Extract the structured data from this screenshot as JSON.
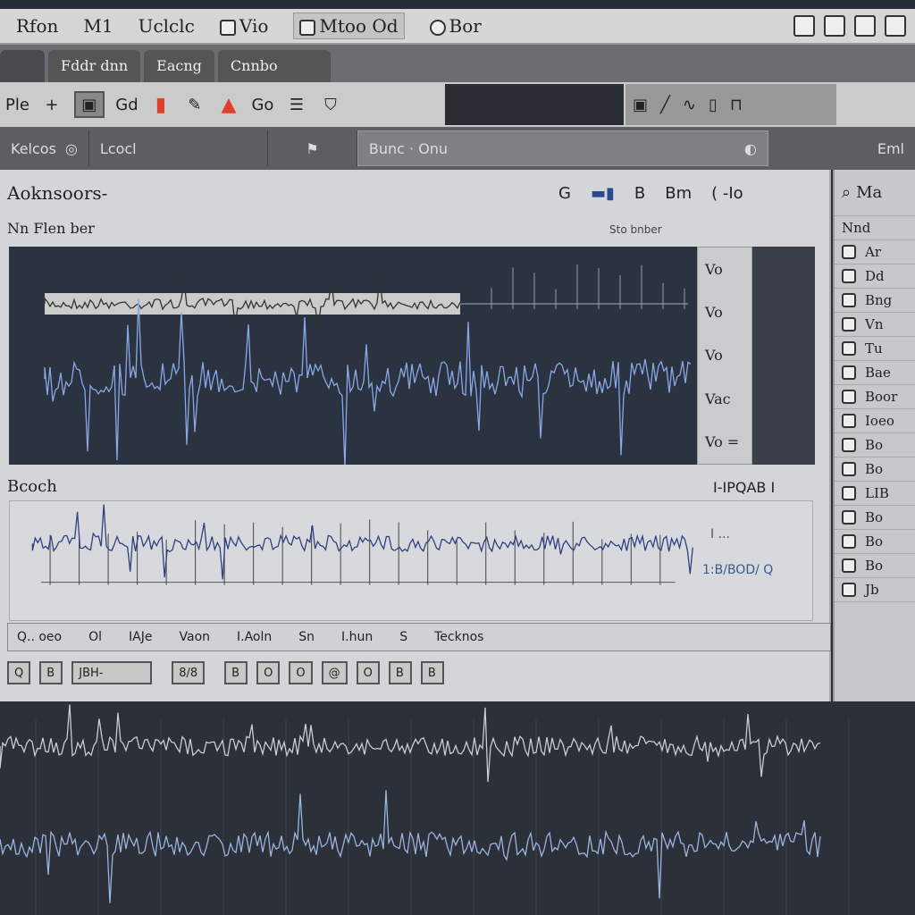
{
  "menubar": {
    "items": [
      "Rfon",
      "M1",
      "Uclclc",
      "Vio",
      "Mtoo Od",
      "Bor"
    ]
  },
  "tabs": [
    "Fddr dnn",
    "Eacng",
    "Cnnbo"
  ],
  "toolbar": {
    "items": [
      "Ple",
      "Gd",
      "Go"
    ]
  },
  "secbar": {
    "left": "Kelcos",
    "mid": "Lcocl",
    "field": "Bunc · Onu",
    "right": "Eml"
  },
  "panel": {
    "title": "Aoknsoors-",
    "subtitle": "Nn Flen ber",
    "subtitle_right": "Sto bnber",
    "tools": [
      "G",
      "B",
      "Bm",
      "( -Io"
    ]
  },
  "dark_plot_side": [
    "Vo",
    "Vo",
    "Vo",
    "Vac",
    "Vo ="
  ],
  "section2": {
    "title": "Bcoch",
    "right": "I-IPQAB I",
    "side_a": "I ...",
    "side_b": "1:B/BOD/ Q"
  },
  "status": [
    "Q.. oeo",
    "Ol",
    "IAJe",
    "Vaon",
    "I.Aoln",
    "Sn",
    "I.hun",
    "S",
    "Tecknos"
  ],
  "buttons": [
    "Q",
    "B",
    "JBH-",
    "8/8",
    "B",
    "O",
    "O",
    "@",
    "O",
    "B",
    "B"
  ],
  "sidebar": {
    "header": "Ma",
    "sub": "Nnd",
    "items": [
      "Ar",
      "Dd",
      "Bng",
      "Vn",
      "Tu",
      "Bae",
      "Boor",
      "Ioeo",
      "Bo",
      "Bo",
      "LIB",
      "Bo",
      "Bo",
      "Bo",
      "Jb"
    ]
  },
  "colors": {
    "accent": "#5a7fd0",
    "warning": "#e0402a",
    "plot_bg": "#2b3240"
  }
}
